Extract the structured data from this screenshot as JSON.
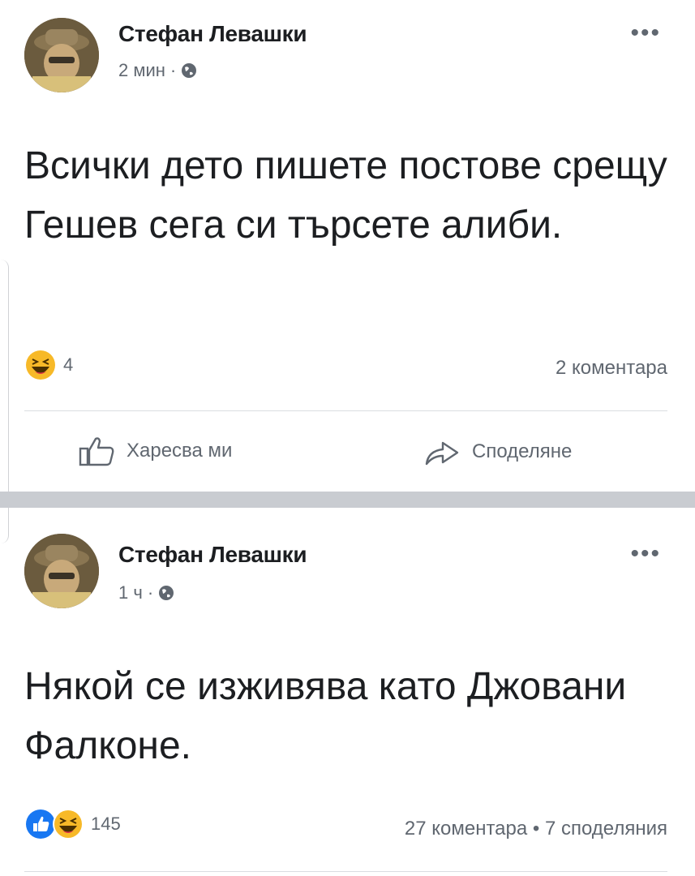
{
  "posts": [
    {
      "author": "Стефан Левашки",
      "time": "2 мин",
      "separator": "·",
      "text": "Всички дето пишете постове срещу Гешев сега си търсете алиби.",
      "reaction_count": "4",
      "stats": "2 коментара",
      "actions": {
        "like": "Харесва ми",
        "share": "Споделяне"
      }
    },
    {
      "author": "Стефан Левашки",
      "time": "1 ч",
      "separator": "·",
      "text": "Някой се изживява като Джовани Фалконе.",
      "reaction_count": "145",
      "stats": "27 коментара • 7 споделяния"
    }
  ],
  "icons": {
    "more": "more-options-icon",
    "privacy": "globe-icon",
    "reaction_haha": "haha-emoji-icon",
    "reaction_like": "like-emoji-icon",
    "like": "thumbs-up-icon",
    "share": "share-arrow-icon"
  },
  "colors": {
    "text": "#1c1e21",
    "secondary": "#606770",
    "like_blue": "#1877f2",
    "haha_yellow": "#f7b928",
    "separator": "#c9ccd1"
  }
}
